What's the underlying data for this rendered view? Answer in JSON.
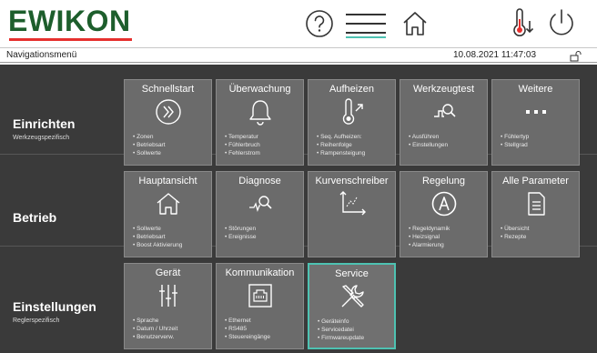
{
  "header": {
    "brand": "EWIKON",
    "nav_title": "Navigationsmenü",
    "datetime": "10.08.2021 11:47:03",
    "icons": [
      "help-icon",
      "menu-icon",
      "home-icon",
      "temperature-down-icon",
      "power-icon",
      "unlock-icon"
    ],
    "colors": {
      "brand": "#1d5e2c",
      "accent_red": "#e6302e",
      "active_teal": "#4ec2b2"
    }
  },
  "rows": [
    {
      "title": "Einrichten",
      "subtitle": "Werkzeugspezifisch",
      "tiles": [
        {
          "title": "Schnellstart",
          "icon": "fast-forward-circle-icon",
          "items": [
            "Zonen",
            "Betriebsart",
            "Sollwerte"
          ]
        },
        {
          "title": "Überwachung",
          "icon": "bell-icon",
          "items": [
            "Temperatur",
            "Fühlerbruch",
            "Fehlerstrom"
          ]
        },
        {
          "title": "Aufheizen",
          "icon": "thermometer-up-icon",
          "items": [
            "Seq. Aufheizen:",
            "Reihenfolge",
            "Rampensteigung"
          ]
        },
        {
          "title": "Werkzeugtest",
          "icon": "signal-search-icon",
          "items": [
            "Ausführen",
            "Einstellungen"
          ]
        },
        {
          "title": "Weitere",
          "icon": "more-dots-icon",
          "items": [
            "Fühlertyp",
            "Stellgrad"
          ]
        }
      ]
    },
    {
      "title": "Betrieb",
      "subtitle": "",
      "tiles": [
        {
          "title": "Hauptansicht",
          "icon": "home-icon",
          "items": [
            "Sollwerte",
            "Betriebsart",
            "Boost Aktivierung"
          ]
        },
        {
          "title": "Diagnose",
          "icon": "diagnosis-search-icon",
          "items": [
            "Störungen",
            "Ereignisse"
          ]
        },
        {
          "title": "Kurvenschreiber",
          "icon": "chart-recorder-icon",
          "items": []
        },
        {
          "title": "Regelung",
          "icon": "auto-circle-icon",
          "items": [
            "Regeldynamik",
            "Heizsignal",
            "Alarmierung"
          ]
        },
        {
          "title": "Alle Parameter",
          "icon": "document-icon",
          "items": [
            "Übersicht",
            "Rezepte"
          ]
        }
      ]
    },
    {
      "title": "Einstellungen",
      "subtitle": "Reglerspezifisch",
      "tiles": [
        {
          "title": "Gerät",
          "icon": "sliders-icon",
          "items": [
            "Sprache",
            "Datum / Uhrzeit",
            "Benutzerverw."
          ]
        },
        {
          "title": "Kommunikation",
          "icon": "ethernet-port-icon",
          "items": [
            "Ethernet",
            "RS485",
            "Steuereingänge"
          ]
        },
        {
          "title": "Service",
          "icon": "tools-icon",
          "items": [
            "Geräteinfo",
            "Servicedatei",
            "Firmwareupdate"
          ],
          "active": true
        }
      ]
    }
  ]
}
